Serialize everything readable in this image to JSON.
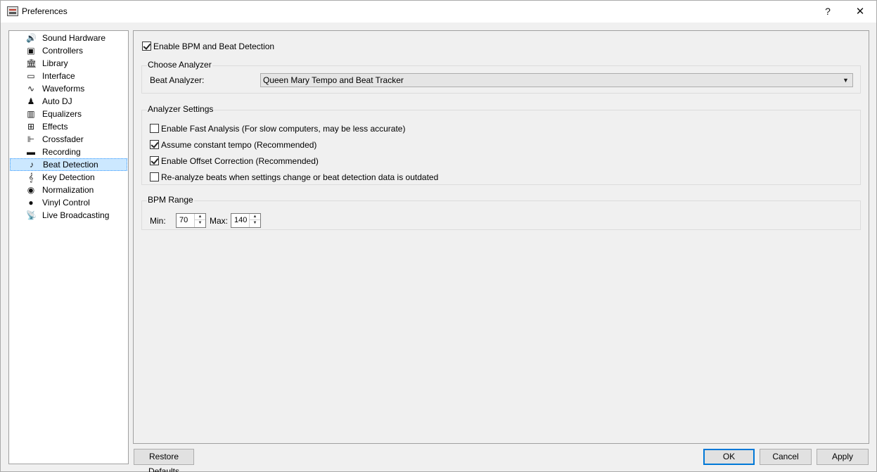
{
  "window": {
    "title": "Preferences",
    "help_label": "?",
    "close_label": "✕"
  },
  "sidebar": {
    "items": [
      {
        "label": "Sound Hardware",
        "icon": "🔊"
      },
      {
        "label": "Controllers",
        "icon": "▣"
      },
      {
        "label": "Library",
        "icon": "🏛"
      },
      {
        "label": "Interface",
        "icon": "▭"
      },
      {
        "label": "Waveforms",
        "icon": "∿"
      },
      {
        "label": "Auto DJ",
        "icon": "♟"
      },
      {
        "label": "Equalizers",
        "icon": "▥"
      },
      {
        "label": "Effects",
        "icon": "⊞"
      },
      {
        "label": "Crossfader",
        "icon": "⊩"
      },
      {
        "label": "Recording",
        "icon": "▬"
      },
      {
        "label": "Beat Detection",
        "icon": "♪"
      },
      {
        "label": "Key Detection",
        "icon": "𝄞"
      },
      {
        "label": "Normalization",
        "icon": "◉"
      },
      {
        "label": "Vinyl Control",
        "icon": "●"
      },
      {
        "label": "Live Broadcasting",
        "icon": "📡"
      }
    ],
    "selected_index": 10
  },
  "main": {
    "enable_bpm": {
      "label": "Enable BPM and Beat Detection",
      "checked": true
    },
    "choose_analyzer": {
      "title": "Choose Analyzer",
      "beat_analyzer_label": "Beat Analyzer:",
      "beat_analyzer_value": "Queen Mary Tempo and Beat Tracker"
    },
    "analyzer_settings": {
      "title": "Analyzer Settings",
      "options": [
        {
          "label": "Enable Fast Analysis (For slow computers, may be less accurate)",
          "checked": false
        },
        {
          "label": "Assume constant tempo (Recommended)",
          "checked": true
        },
        {
          "label": "Enable Offset Correction (Recommended)",
          "checked": true
        },
        {
          "label": "Re-analyze beats when settings change or beat detection data is outdated",
          "checked": false
        }
      ]
    },
    "bpm_range": {
      "title": "BPM Range",
      "min_label": "Min:",
      "min_value": "70",
      "max_label": "Max:",
      "max_value": "140"
    }
  },
  "buttons": {
    "restore_defaults": "Restore Defaults",
    "ok": "OK",
    "cancel": "Cancel",
    "apply": "Apply"
  }
}
